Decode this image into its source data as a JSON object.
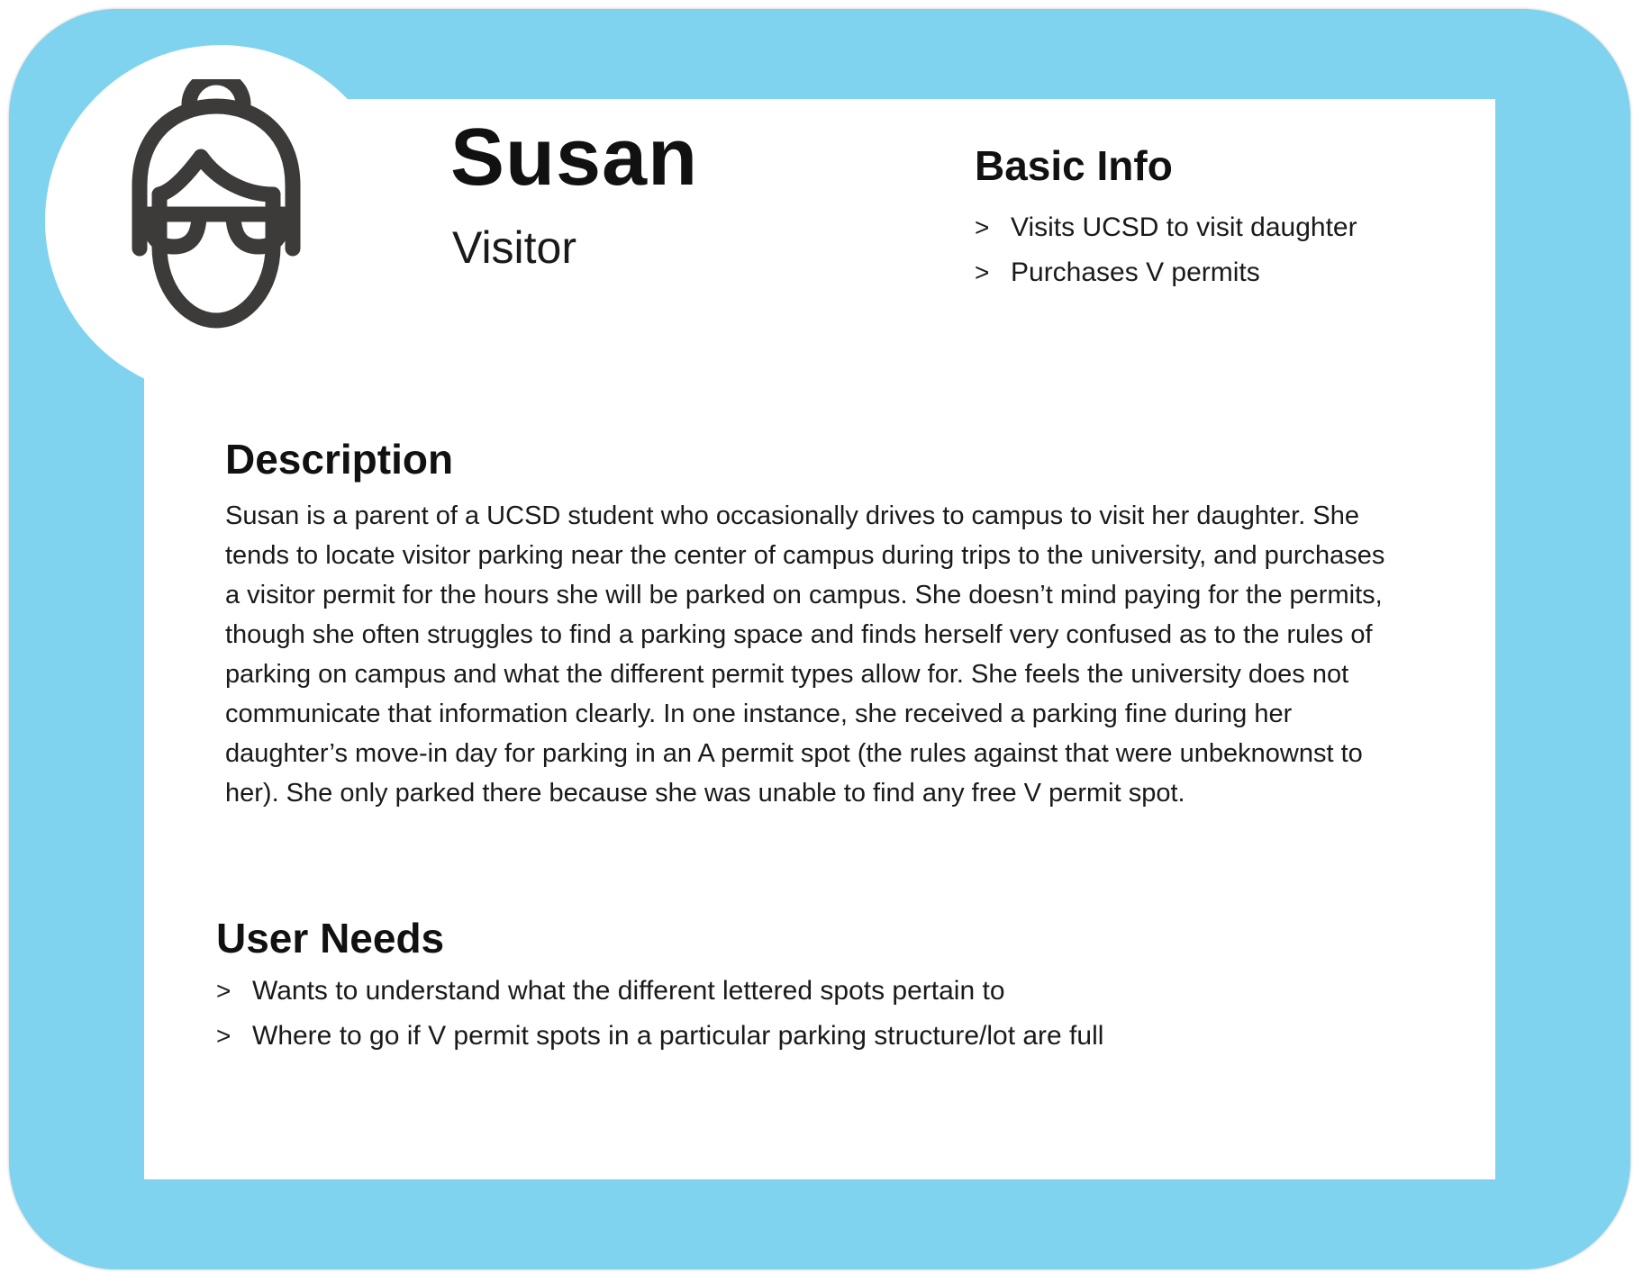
{
  "persona": {
    "name": "Susan",
    "role": "Visitor",
    "avatar_icon": "woman-with-glasses-icon"
  },
  "basic_info": {
    "title": "Basic Info",
    "items": [
      "Visits UCSD to visit daughter",
      "Purchases V permits"
    ]
  },
  "description": {
    "title": "Description",
    "text": "Susan is a parent of a UCSD student who occasionally drives to campus to visit her daughter. She tends to locate visitor parking near the center of campus during trips to the university, and purchases a visitor permit for the hours she will be parked on campus. She doesn’t mind paying for the permits, though she often struggles to find a parking space and finds herself very confused as to the rules of parking on campus and what the different permit types allow for. She feels the university does not communicate that information clearly. In one instance, she received a parking fine during her daughter’s move-in day for parking in an A permit spot (the rules against that were unbeknownst to her).  She only parked there because she was unable to find any free V permit spot."
  },
  "user_needs": {
    "title": "User Needs",
    "items": [
      "Wants to understand what the different lettered spots pertain to",
      "Where to go if V permit spots in a particular parking structure/lot are full"
    ]
  },
  "bullet_glyph": ">",
  "colors": {
    "frame": "#7fd3ef",
    "panel": "#ffffff",
    "icon": "#3d3a3a",
    "text": "#1a1a1a"
  }
}
